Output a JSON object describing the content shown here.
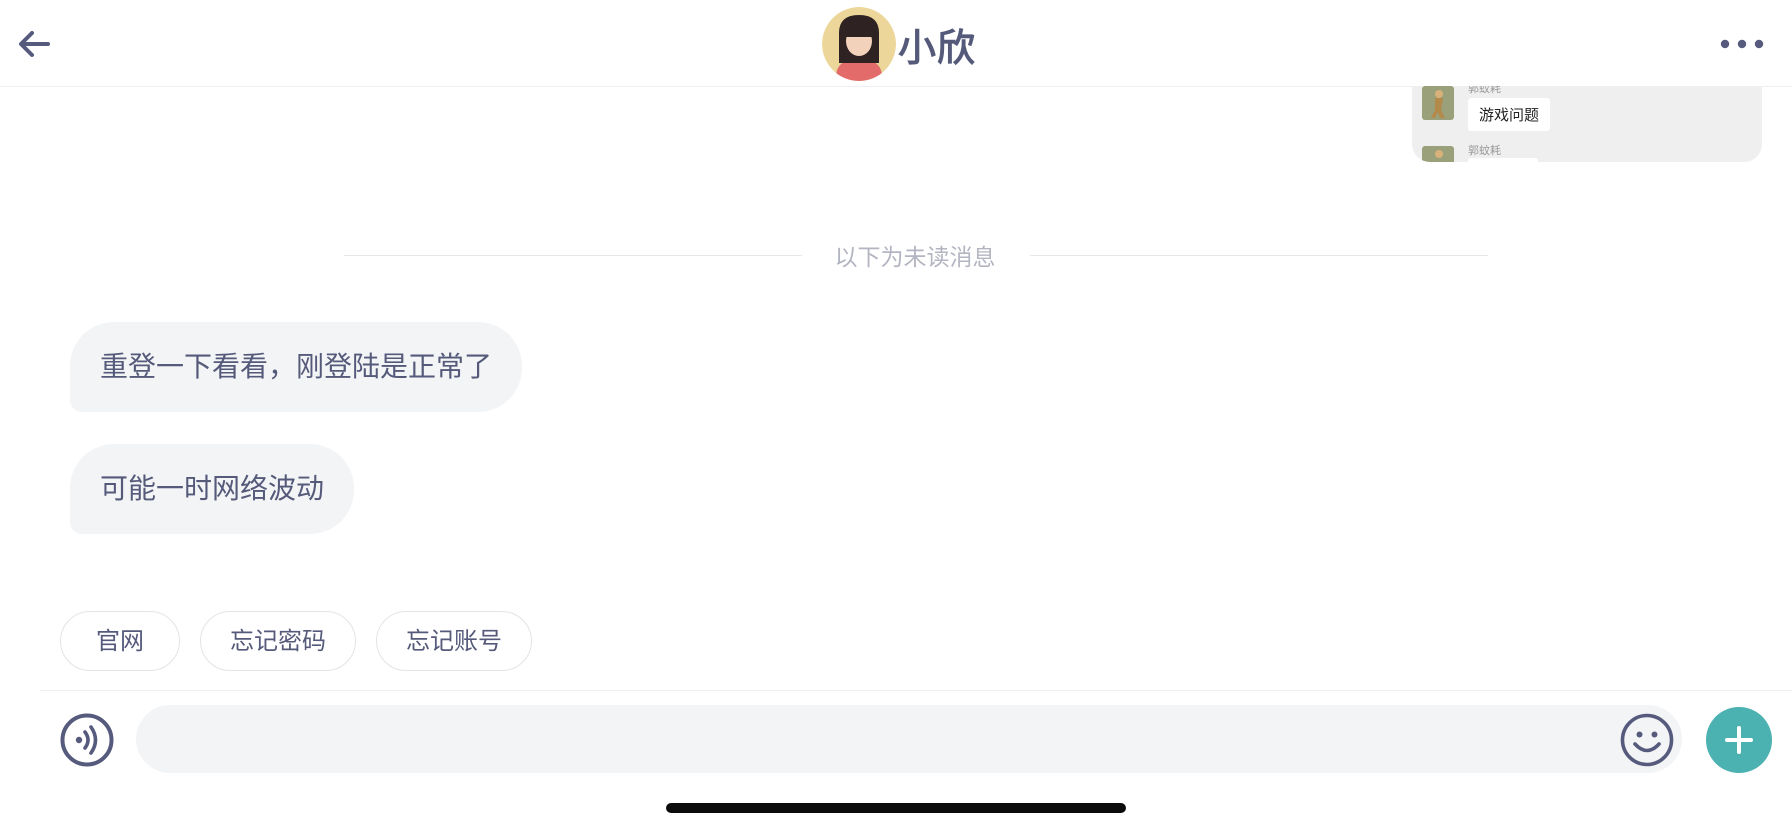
{
  "header": {
    "contact_name": "小欣",
    "back_icon": "arrow-left-icon",
    "more_icon": "more-dots-icon"
  },
  "forwarded_card": {
    "rows": [
      {
        "sender": "郭蚊耗",
        "text": "游戏问题"
      },
      {
        "sender": "郭蚊耗",
        "text": ""
      }
    ]
  },
  "divider": {
    "text": "以下为未读消息"
  },
  "messages": [
    {
      "text": "重登一下看看，刚登陆是正常了"
    },
    {
      "text": "可能一时网络波动"
    }
  ],
  "quick_replies": [
    {
      "label": "官网"
    },
    {
      "label": "忘记密码"
    },
    {
      "label": "忘记账号"
    }
  ],
  "input_bar": {
    "placeholder": "",
    "value": "",
    "voice_icon": "voice-icon",
    "emoji_icon": "smiley-icon",
    "plus_icon": "plus-icon"
  },
  "colors": {
    "accent": "#4cb2b1",
    "text": "#555a7a",
    "bubble": "#f3f4f6",
    "divider_text": "#b3b5c2"
  }
}
